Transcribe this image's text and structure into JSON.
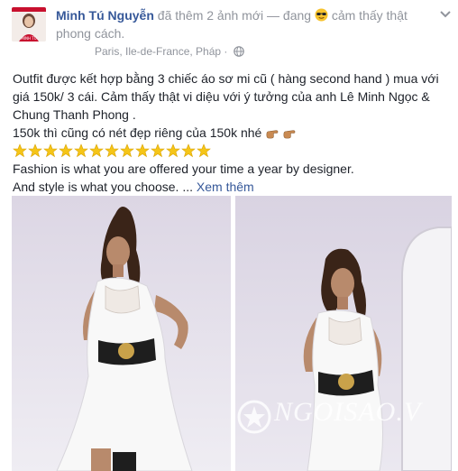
{
  "post": {
    "author": "Minh Tú Nguyễn",
    "action": "đã thêm 2 ảnh mới — đang",
    "feeling": "cảm thấy thật phong cách.",
    "location": "Paris, Ile-de-France, Pháp",
    "separator": "·",
    "avatar_caption": "MINH TÚ",
    "feeling_icon": "sunglasses-emoji-icon",
    "privacy_icon": "globe-icon"
  },
  "content": {
    "paragraph1": "Outfit được kết hợp bằng 3 chiếc áo sơ mi cũ ( hàng second hand ) mua với giá 150k/ 3 cái. Cảm thấy thật vi diệu với ý tưởng của anh Lê Minh Ngọc & Chung Thanh Phong .",
    "paragraph2": "150k thì cũng có nét đẹp riêng của 150k nhé",
    "star_count": 13,
    "line_en1": "Fashion is what you are offered your time a year by designer.",
    "line_en2": "And style is what you choose. ...",
    "see_more": "Xem thêm"
  },
  "photos": {
    "watermark": "NGOISAO.V"
  },
  "colors": {
    "link": "#365899",
    "meta": "#90949c",
    "text": "#1d2129",
    "star": "#f5c518"
  }
}
